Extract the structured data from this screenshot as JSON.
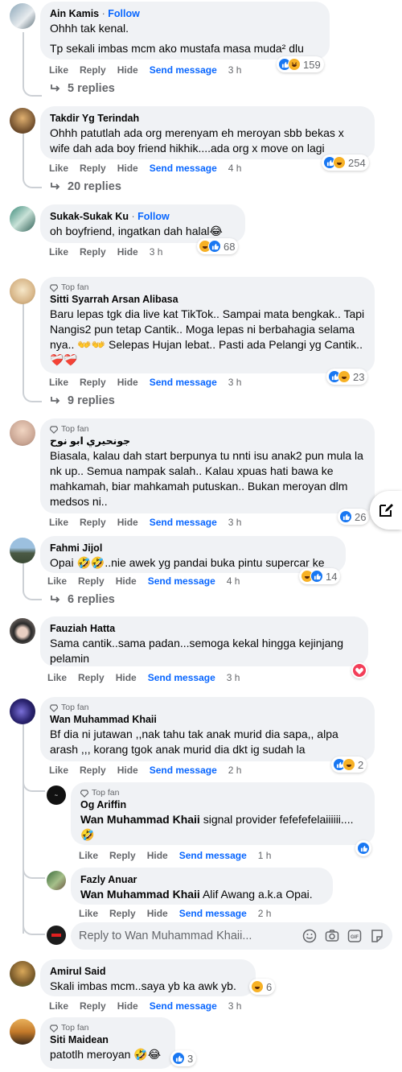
{
  "actions": {
    "like": "Like",
    "reply": "Reply",
    "hide": "Hide",
    "send": "Send message"
  },
  "comments": [
    {
      "name": "Ain Kamis",
      "follow": "Follow",
      "lines": [
        "Ohhh tak kenal.",
        "Tp sekali imbas mcm ako mustafa masa muda² dlu"
      ],
      "time": "3 h",
      "reactions": "159",
      "replies": "5 replies"
    },
    {
      "name": "Takdir Yg Terindah",
      "text": "Ohhh patutlah ada org merenyam eh meroyan sbb bekas x wife dah ada boy friend hikhik....ada org x move on lagi",
      "time": "4 h",
      "reactions": "254",
      "replies": "20 replies"
    },
    {
      "name": "Sukak-Sukak Ku",
      "follow": "Follow",
      "text": "oh boyfriend, ingatkan dah halal😂",
      "time": "3 h",
      "reactions": "68"
    },
    {
      "badge": "Top fan",
      "name": "Sitti Syarrah Arsan Alibasa",
      "text": "Baru lepas tgk dia live kat TikTok.. Sampai mata bengkak.. Tapi Nangis2 pun tetap Cantik.. Moga lepas ni berbahagia selama nya.. 👐👐 Selepas Hujan lebat.. Pasti ada Pelangi yg Cantik.. ❤️‍🩹❤️‍🩹",
      "time": "3 h",
      "reactions": "23",
      "replies": "9 replies"
    },
    {
      "badge": "Top fan",
      "name": "جونحيري ابو نوح",
      "text": "Biasala, kalau dah start berpunya tu nnti isu anak2 pun mula la nk up.. Semua nampak salah.. Kalau xpuas hati bawa ke mahkamah, biar mahkamah putuskan.. Bukan meroyan dlm medsos ni..",
      "time": "3 h",
      "reactions": "26"
    },
    {
      "name": "Fahmi Jijol",
      "text": "Opai 🤣🤣..nie awek yg pandai buka pintu supercar ke",
      "time": "4 h",
      "reactions": "14",
      "replies": "6 replies"
    },
    {
      "name": "Fauziah Hatta",
      "text": "Sama cantik..sama padan...semoga kekal hingga kejinjang pelamin",
      "time": "3 h"
    },
    {
      "badge": "Top fan",
      "name": "Wan Muhammad Khaii",
      "text": "Bf dia ni jutawan ,,nak tahu tak anak murid dia sapa,, alpa arash ,,, korang tgok anak murid dia dkt ig sudah la",
      "time": "2 h",
      "reactions": "2"
    },
    {
      "badge": "Top fan",
      "name": "Og Ariffin",
      "mention": "Wan Muhammad Khaii",
      "text": " signal provider fefefefelaiiiiii....🤣",
      "time": "1 h"
    },
    {
      "name": "Fazly Anuar",
      "mention": "Wan Muhammad Khaii",
      "text": " Alif Awang a.k.a Opai.",
      "time": "2 h"
    },
    {
      "name": "Amirul Said",
      "text": "Skali imbas mcm..saya yb ka awk yb.",
      "time": "3 h",
      "reactions": "6"
    },
    {
      "badge": "Top fan",
      "name": "Siti Maidean",
      "text": "patotlh meroyan 🤣😂",
      "reactions": "3"
    }
  ],
  "reply_box": {
    "placeholder": "Reply to Wan Muhammad Khaii..."
  },
  "icons": {
    "reply_arrow": "reply-arrow-icon",
    "compose": "compose-icon",
    "like": "like-reaction-icon",
    "haha": "haha-reaction-icon",
    "love": "love-reaction-icon",
    "top_fan": "diamond-icon"
  }
}
